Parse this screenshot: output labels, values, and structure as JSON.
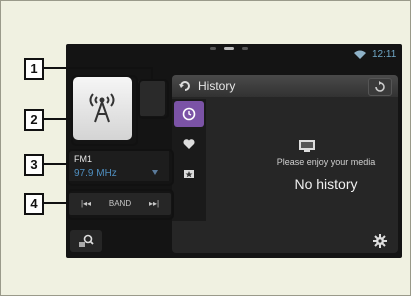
{
  "status_bar": {
    "time": "12:11"
  },
  "tuner": {
    "band": "FM1",
    "frequency": "97.9 MHz"
  },
  "controls": {
    "prev_label": "|◂◂",
    "band_label": "BAND",
    "next_label": "▸▸|"
  },
  "history": {
    "title": "History",
    "message": "Please enjoy your media",
    "empty_text": "No history"
  },
  "callouts": [
    "1",
    "2",
    "3",
    "4"
  ],
  "icons": {
    "tuner": "radio-tower-icon",
    "refresh": "refresh-icon",
    "rotate": "rotate-icon",
    "recent": "clock-icon",
    "favorites": "heart-icon",
    "bookmark": "bookmark-icon",
    "media": "media-icon",
    "search": "search-icon",
    "settings": "gear-icon"
  },
  "colors": {
    "accent": "#7b53a6",
    "frequency": "#4f8fc0",
    "clock": "#6fa7c6"
  }
}
